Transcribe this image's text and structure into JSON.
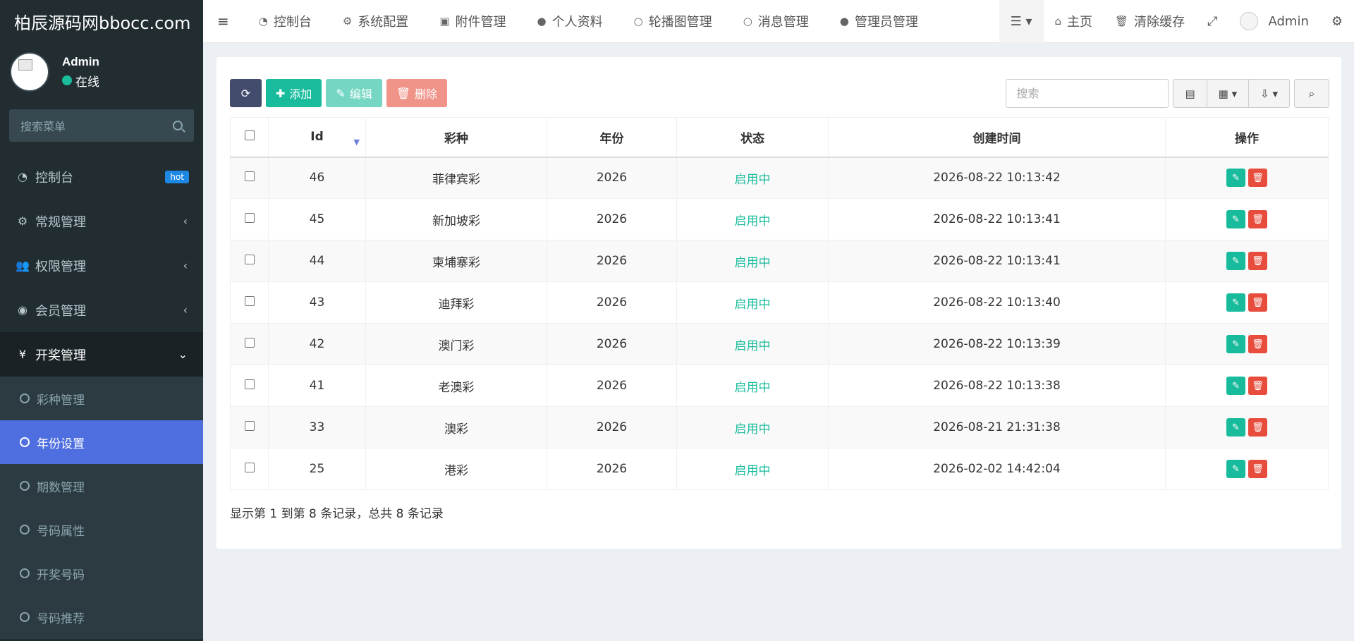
{
  "logo": "柏辰源码网bbocc.com",
  "user": {
    "name": "Admin",
    "status": "在线"
  },
  "sidebar": {
    "search_placeholder": "搜索菜单",
    "items": [
      {
        "label": "控制台",
        "badge": "hot"
      },
      {
        "label": "常规管理"
      },
      {
        "label": "权限管理"
      },
      {
        "label": "会员管理"
      },
      {
        "label": "开奖管理"
      }
    ],
    "sub_items": [
      {
        "label": "彩种管理"
      },
      {
        "label": "年份设置"
      },
      {
        "label": "期数管理"
      },
      {
        "label": "号码属性"
      },
      {
        "label": "开奖号码"
      },
      {
        "label": "号码推荐"
      }
    ]
  },
  "topnav": {
    "items": [
      "控制台",
      "系统配置",
      "附件管理",
      "个人资料",
      "轮播图管理",
      "消息管理",
      "管理员管理"
    ],
    "home": "主页",
    "clear_cache": "清除缓存",
    "admin": "Admin"
  },
  "toolbar": {
    "add": "添加",
    "edit": "编辑",
    "delete": "删除",
    "search_placeholder": "搜索"
  },
  "table": {
    "headers": [
      "Id",
      "彩种",
      "年份",
      "状态",
      "创建时间",
      "操作"
    ],
    "rows": [
      {
        "id": "46",
        "type": "菲律宾彩",
        "year": "2026",
        "status": "启用中",
        "time": "2026-08-22 10:13:42"
      },
      {
        "id": "45",
        "type": "新加坡彩",
        "year": "2026",
        "status": "启用中",
        "time": "2026-08-22 10:13:41"
      },
      {
        "id": "44",
        "type": "柬埔寨彩",
        "year": "2026",
        "status": "启用中",
        "time": "2026-08-22 10:13:41"
      },
      {
        "id": "43",
        "type": "迪拜彩",
        "year": "2026",
        "status": "启用中",
        "time": "2026-08-22 10:13:40"
      },
      {
        "id": "42",
        "type": "澳门彩",
        "year": "2026",
        "status": "启用中",
        "time": "2026-08-22 10:13:39"
      },
      {
        "id": "41",
        "type": "老澳彩",
        "year": "2026",
        "status": "启用中",
        "time": "2026-08-22 10:13:38"
      },
      {
        "id": "33",
        "type": "澳彩",
        "year": "2026",
        "status": "启用中",
        "time": "2026-08-21 21:31:38"
      },
      {
        "id": "25",
        "type": "港彩",
        "year": "2026",
        "status": "启用中",
        "time": "2026-02-02 14:42:04"
      }
    ]
  },
  "pagination": {
    "info": "显示第 1 到第 8 条记录，总共 8 条记录"
  }
}
